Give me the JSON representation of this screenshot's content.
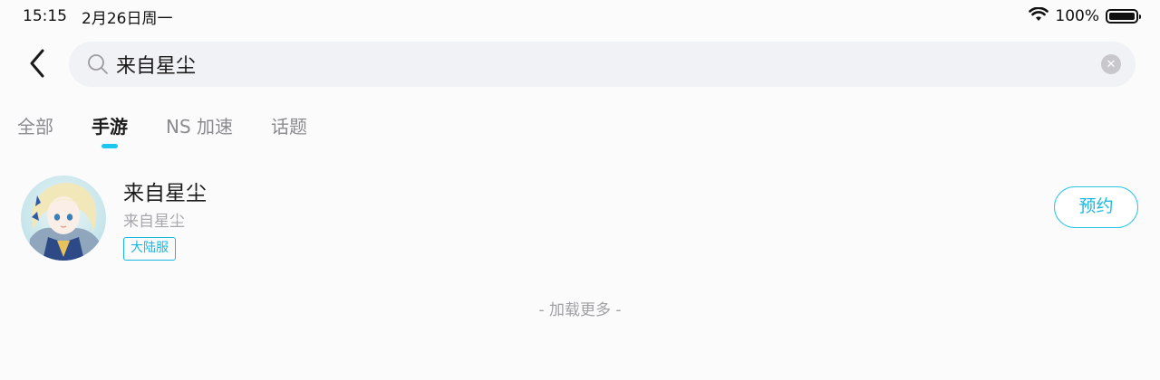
{
  "status_bar": {
    "time": "15:15",
    "date": "2月26日周一",
    "battery_text": "100%",
    "battery_level": 1.0
  },
  "search": {
    "query": "来自星尘",
    "search_icon": "search-icon",
    "clear_icon": "clear-icon",
    "back_icon": "chevron-left-icon"
  },
  "tabs": [
    {
      "label": "全部",
      "active": false
    },
    {
      "label": "手游",
      "active": true
    },
    {
      "label": "NS 加速",
      "active": false
    },
    {
      "label": "话题",
      "active": false
    }
  ],
  "results": [
    {
      "title": "来自星尘",
      "subtitle": "来自星尘",
      "badge": "大陆服",
      "action": "预约",
      "avatar": "game-avatar"
    }
  ],
  "load_more": "- 加载更多 -",
  "colors": {
    "accent": "#1cc7ef",
    "search_bg": "#f1f2f5",
    "muted_text": "#8b8b8f"
  }
}
